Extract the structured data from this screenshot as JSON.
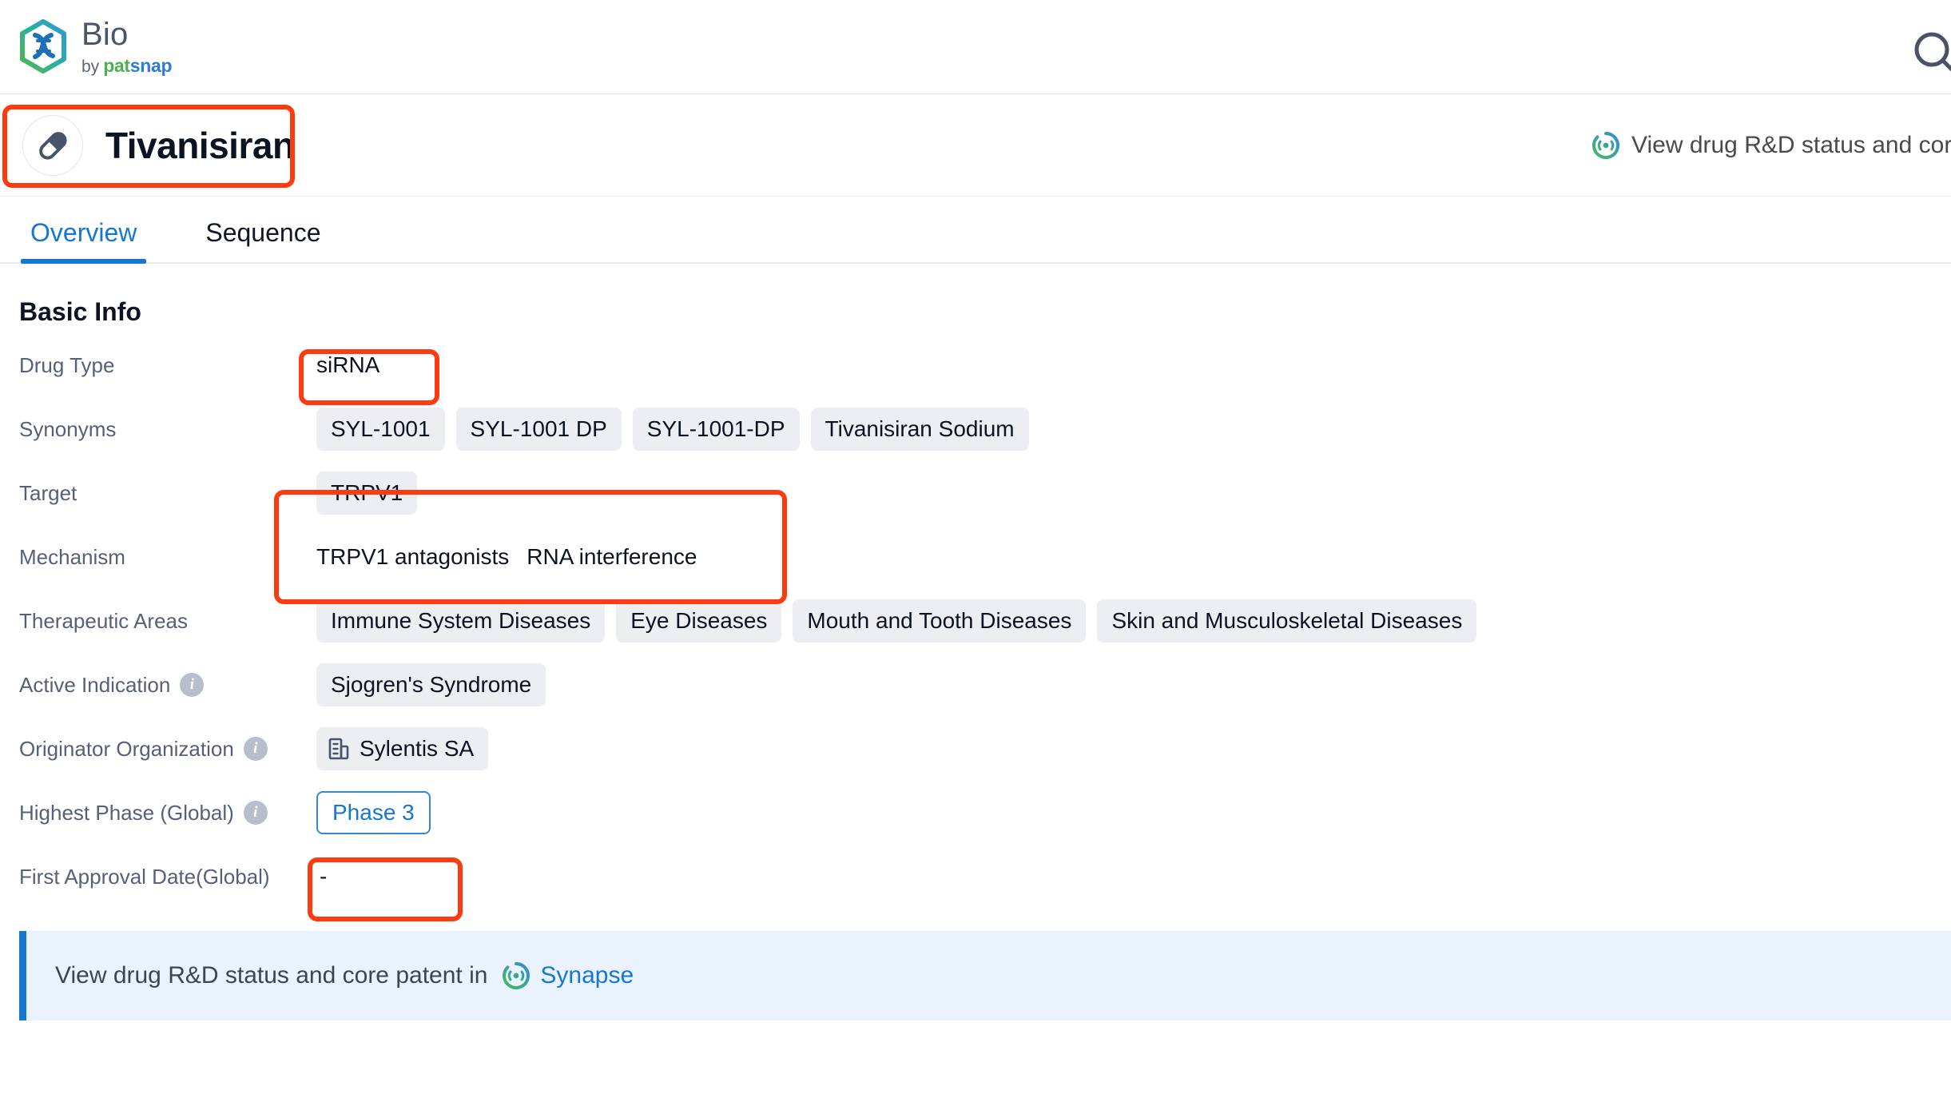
{
  "brand": {
    "title": "Bio",
    "by": "by",
    "pat": "pat",
    "snap": "snap",
    "logo_icon": "dna-hexagon-icon",
    "search_icon": "search-icon"
  },
  "drug_header": {
    "name": "Tivanisiran",
    "avatar_icon": "capsule-pill-icon",
    "link_icon": "synapse-icon",
    "link_text": "View drug R&D status and core"
  },
  "tabs": [
    {
      "label": "Overview",
      "active": true
    },
    {
      "label": "Sequence",
      "active": false
    }
  ],
  "section": {
    "title": "Basic Info"
  },
  "fields": {
    "drug_type": {
      "label": "Drug Type",
      "value": "siRNA"
    },
    "synonyms": {
      "label": "Synonyms",
      "values": [
        "SYL-1001",
        "SYL-1001 DP",
        "SYL-1001-DP",
        "Tivanisiran Sodium"
      ]
    },
    "target": {
      "label": "Target",
      "values": [
        "TRPV1"
      ]
    },
    "mechanism": {
      "label": "Mechanism",
      "values": [
        "TRPV1 antagonists",
        "RNA interference"
      ]
    },
    "therapeutic_areas": {
      "label": "Therapeutic Areas",
      "values": [
        "Immune System Diseases",
        "Eye Diseases",
        "Mouth and Tooth Diseases",
        "Skin and Musculoskeletal Diseases"
      ]
    },
    "active_indication": {
      "label": "Active Indication",
      "info_icon": "info-icon",
      "values": [
        "Sjogren's Syndrome"
      ]
    },
    "originator": {
      "label": "Originator Organization",
      "info_icon": "info-icon",
      "org_icon": "building-icon",
      "values": [
        "Sylentis SA"
      ]
    },
    "highest_phase": {
      "label": "Highest Phase (Global)",
      "info_icon": "info-icon",
      "value": "Phase 3"
    },
    "first_approval": {
      "label": "First Approval Date(Global)",
      "value": "-"
    }
  },
  "banner": {
    "text": "View drug R&D status and core patent in",
    "icon": "synapse-icon",
    "link": "Synapse"
  },
  "colors": {
    "accent_blue": "#1677d2",
    "annotation_red": "#fa3c10",
    "chip_bg": "#eceef2",
    "banner_bg": "#eaf3fd",
    "label_gray": "#56607a",
    "brand_green": "#4caf50"
  }
}
